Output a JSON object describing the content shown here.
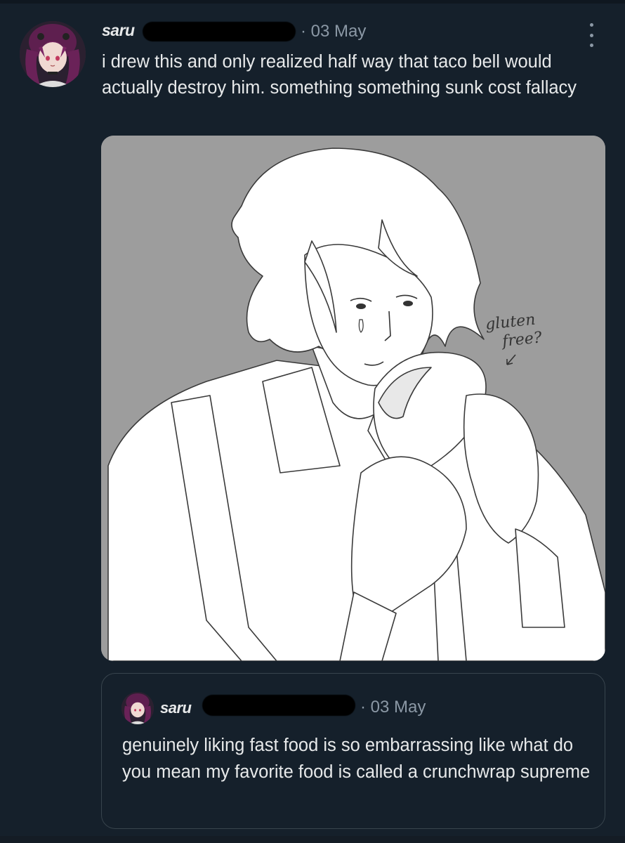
{
  "tweet": {
    "author_name": "saru",
    "date": "· 03 May",
    "text": "i drew this and only realized half way that taco bell would actually destroy him. something something sunk cost fallacy",
    "more_icon": "more-vertical-icon",
    "media": {
      "annotation_line1": "gluten",
      "annotation_line2": "free?"
    }
  },
  "quote": {
    "author_name": "saru",
    "date": "· 03 May",
    "text": "genuinely liking fast food is so embarrassing like what do you mean my favorite food is called a crunchwrap supreme"
  },
  "colors": {
    "background": "#15202b",
    "text": "#e7e9ea",
    "secondary": "#8b98a5",
    "border": "#38444d",
    "media_bg": "#9d9d9d"
  }
}
